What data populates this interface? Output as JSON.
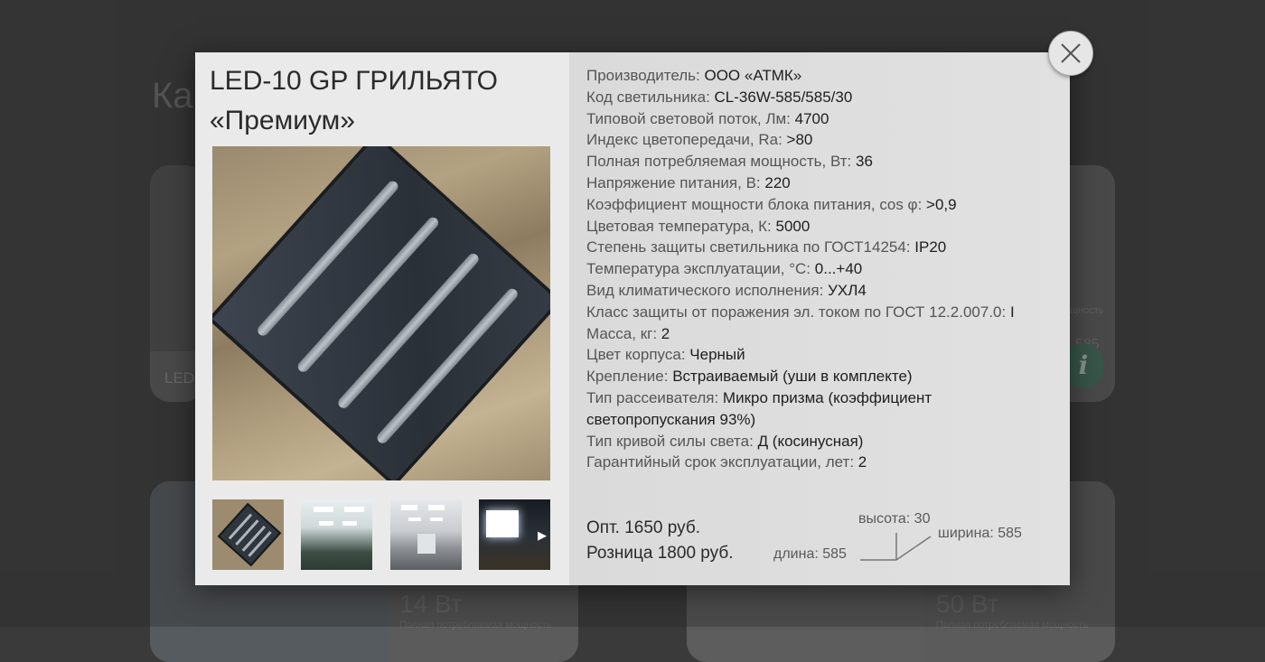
{
  "background": {
    "page_title": "Ка",
    "card1_label": "LED",
    "right_partial_text": "щность",
    "right_partial_value": "585",
    "bottom_left_power": "14 Вт",
    "bottom_left_caption": "Полная потребляемая мощность",
    "bottom_right_power": "50 Вт",
    "bottom_right_caption": "Полная потребляемая мощность"
  },
  "modal": {
    "title_line1": "LED-10 GP ГРИЛЬЯТО",
    "title_line2": "«Премиум»",
    "specs": [
      {
        "label": "Производитель: ",
        "value": "ООО «АТМК»"
      },
      {
        "label": "Код светильника: ",
        "value": "CL-36W-585/585/30"
      },
      {
        "label": "Типовой световой поток, Лм: ",
        "value": "4700"
      },
      {
        "label": "Индекс цветопередачи, Ra: ",
        "value": ">80"
      },
      {
        "label": "Полная потребляемая мощность, Вт: ",
        "value": "36"
      },
      {
        "label": "Напряжение питания, В: ",
        "value": "220"
      },
      {
        "label": "Коэффициент мощности блока питания, cos φ: ",
        "value": ">0,9"
      },
      {
        "label": "Цветовая температура, К: ",
        "value": "5000"
      },
      {
        "label": "Степень защиты светильника по ГОСТ14254: ",
        "value": "IP20"
      },
      {
        "label": "Температура эксплуатации, °С: ",
        "value": "0...+40"
      },
      {
        "label": "Вид климатического исполнения: ",
        "value": "УХЛ4"
      },
      {
        "label": "Класс защиты от поражения эл. током по ГОСТ 12.2.007.0: ",
        "value": "I"
      },
      {
        "label": "Масса, кг: ",
        "value": "2"
      },
      {
        "label": "Цвет корпуса: ",
        "value": "Черный"
      },
      {
        "label": "Крепление: ",
        "value": "Встраиваемый (уши в комплекте)"
      },
      {
        "label": "Тип рассеивателя: ",
        "value": "Микро призма (коэффициент светопропускания 93%)"
      },
      {
        "label": "Тип кривой силы света: ",
        "value": "Д (косинусная)"
      },
      {
        "label": "Гарантийный срок эксплуатации, лет: ",
        "value": "2"
      }
    ],
    "price_wholesale": "Опт. 1650 руб.",
    "price_retail": "Розница 1800 руб.",
    "dimensions": {
      "height": "высота: 30",
      "width": "ширина: 585",
      "length": "длина: 585"
    },
    "gallery_next_icon": "chevron-right-icon",
    "close_icon": "close-icon"
  }
}
